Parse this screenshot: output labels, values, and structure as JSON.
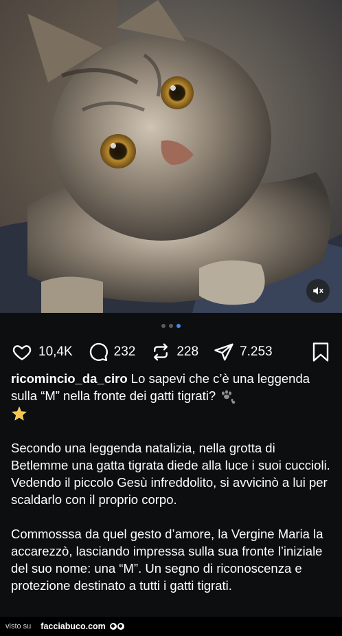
{
  "post": {
    "image_alt": "tabby kitten",
    "carousel": {
      "count": 3,
      "active_index": 3
    },
    "actions": {
      "likes": "10,4K",
      "comments": "232",
      "reposts": "228",
      "shares": "7.253"
    },
    "caption": {
      "username": "ricomincio_da_ciro",
      "intro": " Lo sapevi che c’è una leggenda sulla “M” nella fronte dei gatti tigrati? ",
      "para1": "Secondo una leggenda natalizia, nella grotta di Betlemme una gatta tigrata diede alla luce i suoi cuccioli. Vedendo il piccolo Gesù infreddolito, si avvicinò a lui per scaldarlo con il proprio corpo.",
      "para2": "Commosssa da quel gesto d’amore, la Vergine Maria la accarezzò, lasciando impressa sulla sua fronte l’iniziale del suo nome: una “M”. Un segno di riconoscenza e protezione destinato a tutti i gatti tigrati."
    }
  },
  "footer": {
    "visto_su": "visto su",
    "brand": "facciabuco.com"
  }
}
